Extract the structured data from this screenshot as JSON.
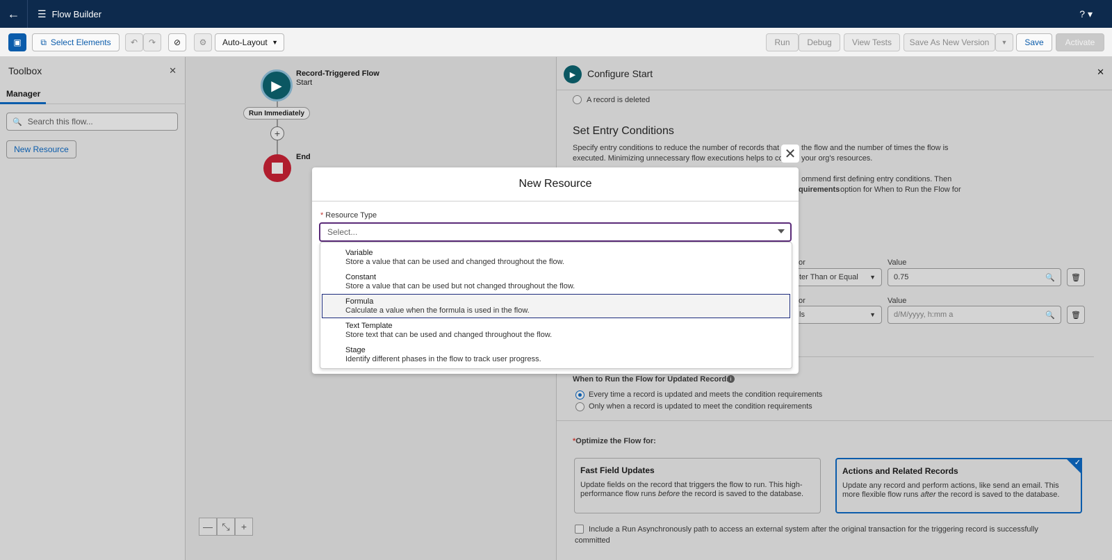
{
  "topbar": {
    "app_title": "Flow Builder",
    "help": "? ▾"
  },
  "toolbar": {
    "select_elements": "Select Elements",
    "auto_layout": "Auto-Layout",
    "run": "Run",
    "debug": "Debug",
    "view_tests": "View Tests",
    "save_as_new_version": "Save As New Version",
    "save": "Save",
    "activate": "Activate"
  },
  "toolbox": {
    "title": "Toolbox",
    "tab": "Manager",
    "search_placeholder": "Search this flow...",
    "new_resource": "New Resource"
  },
  "canvas": {
    "start_title": "Record-Triggered Flow",
    "start_sub": "Start",
    "run_pill": "Run Immediately",
    "end_label": "End"
  },
  "panel": {
    "title": "Configure Start",
    "deleted_option": "A record is deleted",
    "entry_title": "Set Entry Conditions",
    "entry_desc_1": "Specify entry conditions to reduce the number of records that tr",
    "entry_desc_1b": "the flow and the number of times the flow is",
    "entry_desc_2": "executed. Minimizing unnecessary flow executions helps to cons",
    "entry_desc_2b": "your org's resources.",
    "entry_desc_3": "ommend first defining entry conditions. Then",
    "entry_desc_4_bold": "quirements",
    "entry_desc_4": "option for When to Run the Flow for",
    "operator_label": "or",
    "value_label": "Value",
    "row1_operator": "ter Than or Equal",
    "row1_value": "0.75",
    "row2_operator": "ls",
    "row2_value_placeholder": "d/M/yyyy, h:mm a",
    "when_run_title": "When to Run the Flow for Updated Records",
    "when_opt_1": "Every time a record is updated and meets the condition requirements",
    "when_opt_2": "Only when a record is updated to meet the condition requirements",
    "optimize_title": "Optimize the Flow for:",
    "card1_title": "Fast Field Updates",
    "card1_desc_a": "Update fields on the record that triggers the flow to run. This high-performance flow runs",
    "card1_desc_em": "before",
    "card1_desc_b": "the record is saved to the database.",
    "card2_title": "Actions and Related Records",
    "card2_desc_a": "Update any record and perform actions, like send an email. This more flexible flow runs",
    "card2_desc_em": "after",
    "card2_desc_b": "the record is saved to the database.",
    "async_text": "Include a Run Asynchronously path to access an external system after the original transaction for the triggering record is successfully committed"
  },
  "modal": {
    "title": "New Resource",
    "field_label": "Resource Type",
    "select_placeholder": "Select...",
    "options": [
      {
        "name": "Variable",
        "desc": "Store a value that can be used and changed throughout the flow."
      },
      {
        "name": "Constant",
        "desc": "Store a value that can be used but not changed throughout the flow."
      },
      {
        "name": "Formula",
        "desc": "Calculate a value when the formula is used in the flow."
      },
      {
        "name": "Text Template",
        "desc": "Store text that can be used and changed throughout the flow."
      },
      {
        "name": "Stage",
        "desc": "Identify different phases in the flow to track user progress."
      }
    ]
  }
}
